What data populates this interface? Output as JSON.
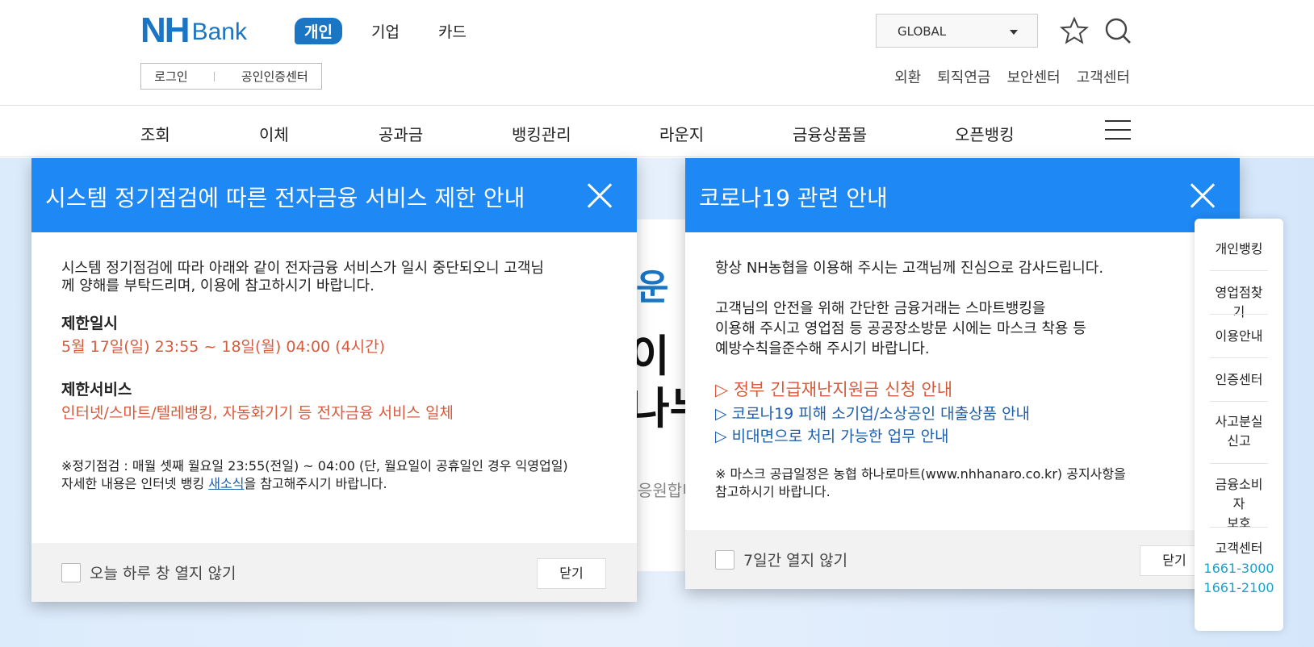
{
  "header": {
    "logo_nh": "NH",
    "logo_bank": "Bank",
    "tabs": [
      "개인",
      "기업",
      "카드"
    ],
    "login": "로그인",
    "cert_center": "공인인증센터",
    "global_select": "GLOBAL",
    "util_links": [
      "외환",
      "퇴직연금",
      "보안센터",
      "고객센터"
    ]
  },
  "nav": {
    "items": [
      "조회",
      "이체",
      "공과금",
      "뱅킹관리",
      "라운지",
      "금융상품몰",
      "오픈뱅킹"
    ]
  },
  "banner": {
    "t1": "운 ",
    "t2": "이",
    "t3": "나누",
    "t4": "응원합니"
  },
  "popup1": {
    "title": "시스템 정기점검에 따른 전자금융 서비스 제한 안내",
    "intro_line1": "시스템 정기점검에 따라 아래와 같이 전자금융 서비스가 일시 중단되오니 고객님",
    "intro_line2": "께 양해를 부탁드리며, 이용에 참고하시기 바랍니다.",
    "period_heading": "제한일시",
    "period_value": "5월 17일(일) 23:55 ~ 18일(월) 04:00 (4시간)",
    "service_heading": "제한서비스",
    "service_value": "인터넷/스마트/텔레뱅킹, 자동화기기 등 전자금융 서비스 일체",
    "note_line1": "※정기점검 : 매월 셋째 월요일 23:55(전일) ~ 04:00 (단, 월요일이 공휴일인 경우 익영업일)",
    "note_line2_pre": "자세한 내용은 인터넷 뱅킹 ",
    "note_link": "새소식",
    "note_line2_post": "을 참고해주시기 바랍니다.",
    "checkbox_label": "오늘 하루 창 열지 않기",
    "close_label": "닫기"
  },
  "popup2": {
    "title": "코로나19 관련 안내",
    "line1": "항상 NH농협을 이용해 주시는 고객님께 진심으로 감사드립니다.",
    "line2": "고객님의 안전을 위해 간단한 금융거래는 스마트뱅킹을",
    "line3": "이용해 주시고 영업점 등 공공장소방문 시에는 마스크 착용 등",
    "line4": "예방수칙을준수해 주시기 바랍니다.",
    "link1": "▷ 정부 긴급재난지원금 신청 안내",
    "link2": "▷ 코로나19 피해 소기업/소상공인 대출상품 안내",
    "link3": "▷ 비대면으로 처리 가능한 업무 안내",
    "note_line1": "※ 마스크 공급일정은 농협 하나로마트(www.nhhanaro.co.kr) 공지사항을",
    "note_line2": "참고하시기 바랍니다.",
    "checkbox_label": "7일간 열지 않기",
    "close_label": "닫기"
  },
  "quick_menu": {
    "items": [
      "개인뱅킹",
      "영업점찾기",
      "이용안내",
      "인증센터"
    ],
    "loss_line1": "사고분실",
    "loss_line2": "신고",
    "protect_line1": "금융소비자",
    "protect_line2": "보호",
    "customer": "고객센터",
    "phone1": "1661-3000",
    "phone2": "1661-2100"
  },
  "colors": {
    "brand_blue": "#1a75c4",
    "popup_header": "#1e88f5",
    "alert_red": "#d85a3c",
    "link_blue": "#1b5fae",
    "phone_teal": "#1aa3c8"
  }
}
